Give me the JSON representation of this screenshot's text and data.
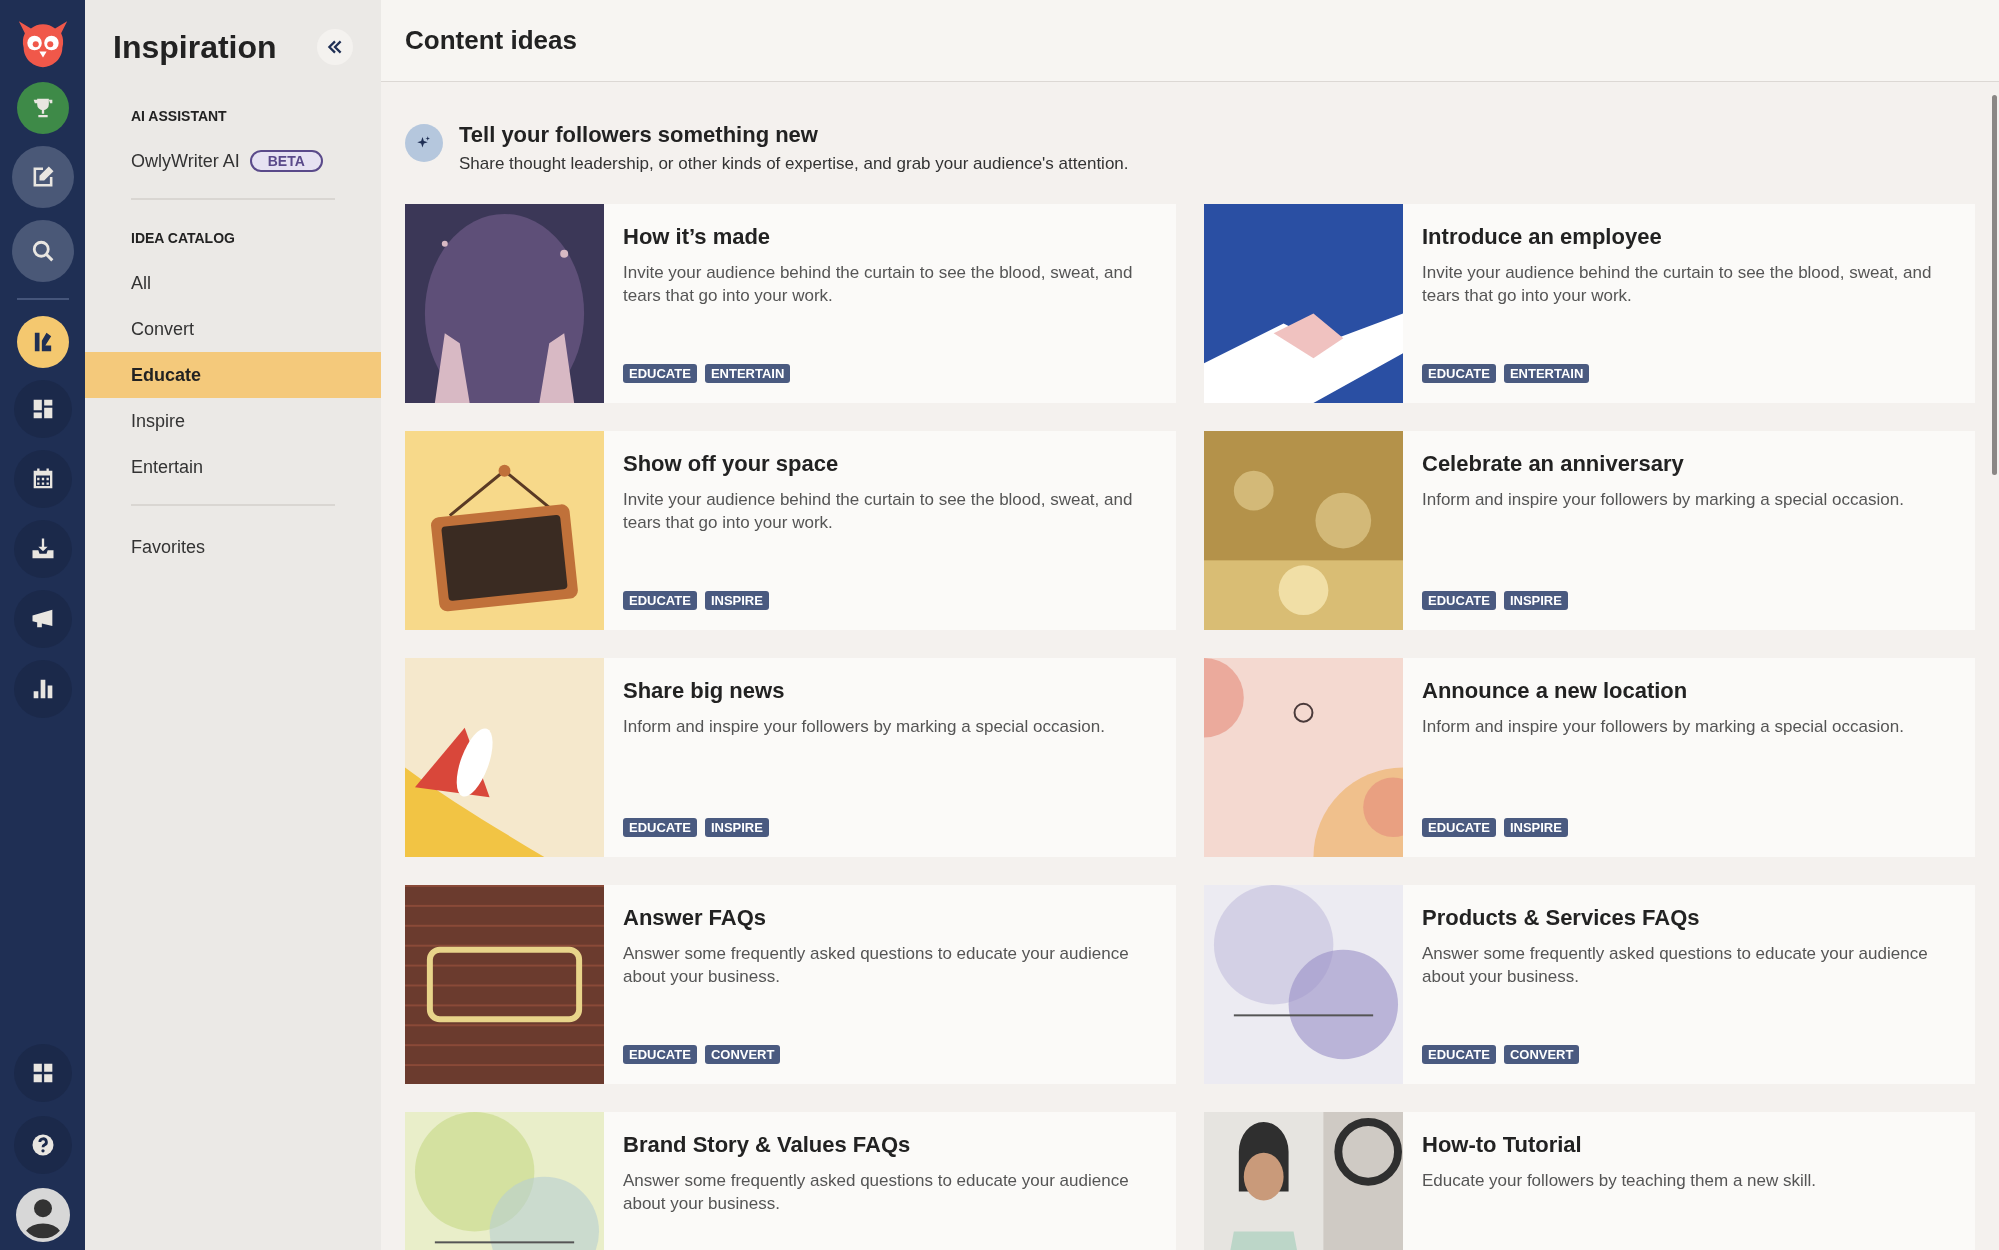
{
  "rail": {
    "items": [
      {
        "kind": "trophy",
        "selected": false
      },
      {
        "kind": "compose",
        "selected": false
      },
      {
        "kind": "search",
        "selected": false
      },
      {
        "kind": "inspiration",
        "selected": true
      },
      {
        "kind": "dashboard",
        "selected": false
      },
      {
        "kind": "calendar",
        "selected": false
      },
      {
        "kind": "inbox",
        "selected": false
      },
      {
        "kind": "megaphone",
        "selected": false
      },
      {
        "kind": "analytics",
        "selected": false
      }
    ],
    "bottom": [
      {
        "kind": "apps"
      },
      {
        "kind": "help"
      },
      {
        "kind": "avatar"
      }
    ]
  },
  "sidebar": {
    "title": "Inspiration",
    "sections": [
      {
        "heading": "AI ASSISTANT",
        "items": [
          {
            "label": "OwlyWriter AI",
            "badge": "BETA",
            "selected": false
          }
        ]
      },
      {
        "heading": "IDEA CATALOG",
        "items": [
          {
            "label": "All",
            "selected": false
          },
          {
            "label": "Convert",
            "selected": false
          },
          {
            "label": "Educate",
            "selected": true
          },
          {
            "label": "Inspire",
            "selected": false
          },
          {
            "label": "Entertain",
            "selected": false
          }
        ]
      },
      {
        "items": [
          {
            "label": "Favorites",
            "selected": false
          }
        ]
      }
    ]
  },
  "header": {
    "title": "Content ideas"
  },
  "intro": {
    "title": "Tell your followers something new",
    "text": "Share thought leadership, or other kinds of expertise, and grab your audience's attention."
  },
  "cards": [
    {
      "title": "How it’s made",
      "text": "Invite your audience behind the curtain to see the blood, sweat, and tears that go into your work.",
      "tags": [
        "EDUCATE",
        "ENTERTAIN"
      ]
    },
    {
      "title": "Introduce an employee",
      "text": "Invite your audience behind the curtain to see the blood, sweat, and tears that go into your work.",
      "tags": [
        "EDUCATE",
        "ENTERTAIN"
      ]
    },
    {
      "title": "Show off your space",
      "text": "Invite your audience behind the curtain to see the blood, sweat, and tears that go into your work.",
      "tags": [
        "EDUCATE",
        "INSPIRE"
      ]
    },
    {
      "title": "Celebrate an anniversary",
      "text": "Inform and inspire your followers by marking a special occasion.",
      "tags": [
        "EDUCATE",
        "INSPIRE"
      ]
    },
    {
      "title": "Share big news",
      "text": "Inform and inspire your followers by marking a special occasion.",
      "tags": [
        "EDUCATE",
        "INSPIRE"
      ]
    },
    {
      "title": "Announce a new location",
      "text": "Inform and inspire your followers by marking a special occasion.",
      "tags": [
        "EDUCATE",
        "INSPIRE"
      ]
    },
    {
      "title": "Answer FAQs",
      "text": "Answer some frequently asked questions to educate your audience about your business.",
      "tags": [
        "EDUCATE",
        "CONVERT"
      ]
    },
    {
      "title": "Products & Services FAQs",
      "text": "Answer some frequently asked questions to educate your audience about your business.",
      "tags": [
        "EDUCATE",
        "CONVERT"
      ]
    },
    {
      "title": "Brand Story & Values FAQs",
      "text": "Answer some frequently asked questions to educate your audience about your business."
    },
    {
      "title": "How-to Tutorial",
      "text": "Educate your followers by teaching them a new skill."
    }
  ]
}
